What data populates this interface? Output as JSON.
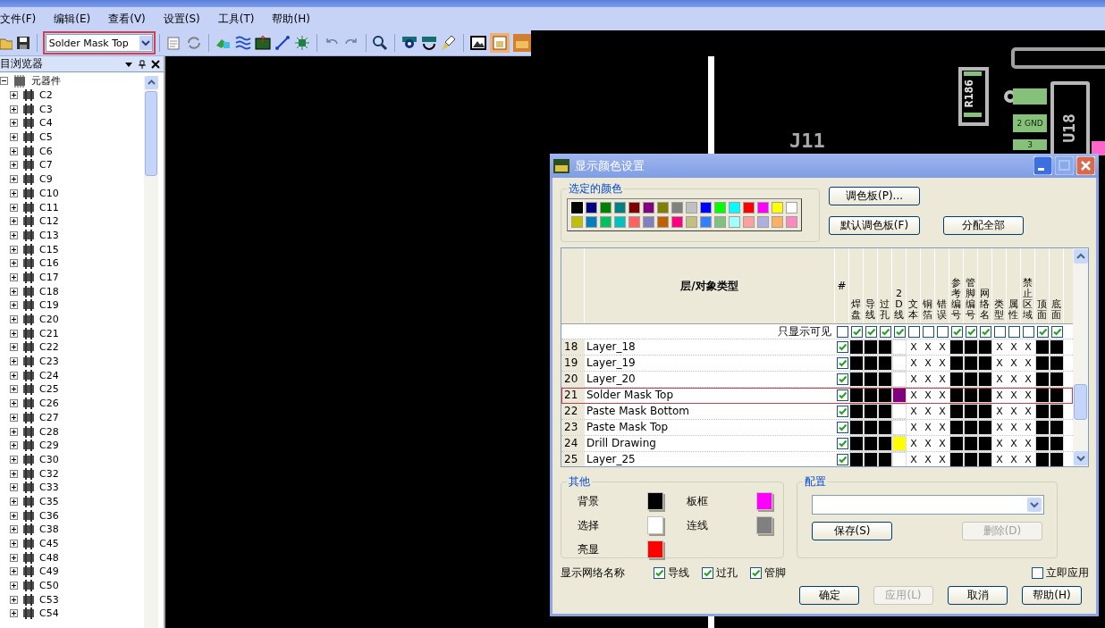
{
  "menu": [
    "文件(F)",
    "编辑(E)",
    "查看(V)",
    "设置(S)",
    "工具(T)",
    "帮助(H)"
  ],
  "toolbar": {
    "layer_select": "Solder Mask Top"
  },
  "browser": {
    "title": "目浏览器",
    "tree": [
      {
        "label": "元器件",
        "expanded": true,
        "children": [
          {
            "label": "C2",
            "expanded": false
          },
          {
            "label": "C3",
            "expanded": false
          },
          {
            "label": "C4",
            "expanded": false
          },
          {
            "label": "C5",
            "expanded": false
          },
          {
            "label": "C6",
            "expanded": false
          },
          {
            "label": "C7",
            "expanded": false
          },
          {
            "label": "C9",
            "expanded": false
          },
          {
            "label": "C10",
            "expanded": false
          },
          {
            "label": "C11",
            "expanded": false
          },
          {
            "label": "C12",
            "expanded": false
          },
          {
            "label": "C13",
            "expanded": false
          },
          {
            "label": "C15",
            "expanded": false
          },
          {
            "label": "C16",
            "expanded": false
          },
          {
            "label": "C17",
            "expanded": false
          },
          {
            "label": "C18",
            "expanded": false
          },
          {
            "label": "C19",
            "expanded": false
          },
          {
            "label": "C20",
            "expanded": false
          },
          {
            "label": "C21",
            "expanded": false
          },
          {
            "label": "C22",
            "expanded": false
          },
          {
            "label": "C23",
            "expanded": false
          },
          {
            "label": "C24",
            "expanded": false
          },
          {
            "label": "C25",
            "expanded": false
          },
          {
            "label": "C26",
            "expanded": false
          },
          {
            "label": "C27",
            "expanded": false
          },
          {
            "label": "C28",
            "expanded": false
          },
          {
            "label": "C29",
            "expanded": false
          },
          {
            "label": "C30",
            "expanded": false
          },
          {
            "label": "C32",
            "expanded": false
          },
          {
            "label": "C33",
            "expanded": false
          },
          {
            "label": "C35",
            "expanded": false
          },
          {
            "label": "C36",
            "expanded": false
          },
          {
            "label": "C38",
            "expanded": false
          },
          {
            "label": "C45",
            "expanded": false
          },
          {
            "label": "C48",
            "expanded": false
          },
          {
            "label": "C49",
            "expanded": false
          },
          {
            "label": "C50",
            "expanded": false
          },
          {
            "label": "C53",
            "expanded": false
          },
          {
            "label": "C54",
            "expanded": false
          }
        ]
      }
    ]
  },
  "pcb": {
    "ref_labels": [
      "J11",
      "R186",
      "U18"
    ],
    "pad_labels": [
      "2 GND",
      "3"
    ]
  },
  "dialog": {
    "title": "显示颜色设置",
    "selected_colors": {
      "title": "选定的颜色",
      "swatches": [
        {
          "color": "#000000",
          "selected": true
        },
        {
          "color": "#000080",
          "selected": false
        },
        {
          "color": "#008000",
          "selected": false
        },
        {
          "color": "#008080",
          "selected": false
        },
        {
          "color": "#800000",
          "selected": false
        },
        {
          "color": "#800080",
          "selected": false
        },
        {
          "color": "#808000",
          "selected": false
        },
        {
          "color": "#808080",
          "selected": false
        },
        {
          "color": "#c0c0c0",
          "selected": false
        },
        {
          "color": "#0000ff",
          "selected": false
        },
        {
          "color": "#00ff00",
          "selected": false
        },
        {
          "color": "#00ffff",
          "selected": false
        },
        {
          "color": "#ff0000",
          "selected": false
        },
        {
          "color": "#ff00ff",
          "selected": false
        },
        {
          "color": "#ffff00",
          "selected": false
        },
        {
          "color": "#ffffff",
          "selected": false
        },
        {
          "color": "#c0c000",
          "selected": false
        },
        {
          "color": "#0080c0",
          "selected": false
        },
        {
          "color": "#00c060",
          "selected": false
        },
        {
          "color": "#00c0c0",
          "selected": false
        },
        {
          "color": "#ff6060",
          "selected": false
        },
        {
          "color": "#8080c0",
          "selected": false
        },
        {
          "color": "#c06000",
          "selected": false
        },
        {
          "color": "#ff0080",
          "selected": false
        },
        {
          "color": "#c0c080",
          "selected": false
        },
        {
          "color": "#3080ff",
          "selected": false
        },
        {
          "color": "#80c080",
          "selected": false
        },
        {
          "color": "#a0ffff",
          "selected": false
        },
        {
          "color": "#ffa0a0",
          "selected": false
        },
        {
          "color": "#b0b0e0",
          "selected": false
        },
        {
          "color": "#ffb060",
          "selected": false
        },
        {
          "color": "#ff88c0",
          "selected": false
        }
      ]
    },
    "palette_buttons": [
      "调色板(P)...",
      "默认调色板(F)",
      "分配全部"
    ],
    "table": {
      "header_name": "层/对象类型",
      "header_hash": "#",
      "columns": [
        "焊盘",
        "导线",
        "过孔",
        "2D线",
        "文本",
        "铜箔",
        "错误",
        "参考编号",
        "管脚编号",
        "网络名",
        "类型",
        "属性",
        "禁止区域",
        "顶面",
        "底面"
      ],
      "visible_only": {
        "label": "只显示可见",
        "hash_checked": false,
        "checks": [
          true,
          true,
          true,
          true,
          false,
          false,
          false,
          true,
          true,
          true,
          false,
          false,
          false,
          true,
          true
        ]
      },
      "rows": [
        {
          "num": "18",
          "name": "Layer_18",
          "checked": true,
          "selected": false,
          "cells": [
            {
              "kind": "color",
              "color": "#000000"
            },
            {
              "kind": "color",
              "color": "#000000"
            },
            {
              "kind": "color",
              "color": "#000000"
            },
            {
              "kind": "color",
              "color": "#ffffff"
            },
            {
              "kind": "na",
              "text": "X"
            },
            {
              "kind": "na",
              "text": "X"
            },
            {
              "kind": "na",
              "text": "X"
            },
            {
              "kind": "color",
              "color": "#000000"
            },
            {
              "kind": "color",
              "color": "#000000"
            },
            {
              "kind": "color",
              "color": "#000000"
            },
            {
              "kind": "na",
              "text": "X"
            },
            {
              "kind": "na",
              "text": "X"
            },
            {
              "kind": "na",
              "text": "X"
            },
            {
              "kind": "color",
              "color": "#000000"
            },
            {
              "kind": "color",
              "color": "#000000"
            }
          ]
        },
        {
          "num": "19",
          "name": "Layer_19",
          "checked": true,
          "selected": false,
          "cells": [
            {
              "kind": "color",
              "color": "#000000"
            },
            {
              "kind": "color",
              "color": "#000000"
            },
            {
              "kind": "color",
              "color": "#000000"
            },
            {
              "kind": "color",
              "color": "#ffffff"
            },
            {
              "kind": "na",
              "text": "X"
            },
            {
              "kind": "na",
              "text": "X"
            },
            {
              "kind": "na",
              "text": "X"
            },
            {
              "kind": "color",
              "color": "#000000"
            },
            {
              "kind": "color",
              "color": "#000000"
            },
            {
              "kind": "color",
              "color": "#000000"
            },
            {
              "kind": "na",
              "text": "X"
            },
            {
              "kind": "na",
              "text": "X"
            },
            {
              "kind": "na",
              "text": "X"
            },
            {
              "kind": "color",
              "color": "#000000"
            },
            {
              "kind": "color",
              "color": "#000000"
            }
          ]
        },
        {
          "num": "20",
          "name": "Layer_20",
          "checked": true,
          "selected": false,
          "cells": [
            {
              "kind": "color",
              "color": "#000000"
            },
            {
              "kind": "color",
              "color": "#000000"
            },
            {
              "kind": "color",
              "color": "#000000"
            },
            {
              "kind": "color",
              "color": "#ffffff"
            },
            {
              "kind": "na",
              "text": "X"
            },
            {
              "kind": "na",
              "text": "X"
            },
            {
              "kind": "na",
              "text": "X"
            },
            {
              "kind": "color",
              "color": "#000000"
            },
            {
              "kind": "color",
              "color": "#000000"
            },
            {
              "kind": "color",
              "color": "#000000"
            },
            {
              "kind": "na",
              "text": "X"
            },
            {
              "kind": "na",
              "text": "X"
            },
            {
              "kind": "na",
              "text": "X"
            },
            {
              "kind": "color",
              "color": "#000000"
            },
            {
              "kind": "color",
              "color": "#000000"
            }
          ]
        },
        {
          "num": "21",
          "name": "Solder Mask Top",
          "checked": true,
          "selected": true,
          "cells": [
            {
              "kind": "color",
              "color": "#000000"
            },
            {
              "kind": "color",
              "color": "#000000"
            },
            {
              "kind": "color",
              "color": "#000000"
            },
            {
              "kind": "color",
              "color": "#800080"
            },
            {
              "kind": "na",
              "text": "X"
            },
            {
              "kind": "na",
              "text": "X"
            },
            {
              "kind": "na",
              "text": "X"
            },
            {
              "kind": "color",
              "color": "#000000"
            },
            {
              "kind": "color",
              "color": "#000000"
            },
            {
              "kind": "color",
              "color": "#000000"
            },
            {
              "kind": "na",
              "text": "X"
            },
            {
              "kind": "na",
              "text": "X"
            },
            {
              "kind": "na",
              "text": "X"
            },
            {
              "kind": "color",
              "color": "#000000"
            },
            {
              "kind": "color",
              "color": "#000000"
            }
          ]
        },
        {
          "num": "22",
          "name": "Paste Mask Bottom",
          "checked": true,
          "selected": false,
          "cells": [
            {
              "kind": "color",
              "color": "#000000"
            },
            {
              "kind": "color",
              "color": "#000000"
            },
            {
              "kind": "color",
              "color": "#000000"
            },
            {
              "kind": "color",
              "color": "#ffffff"
            },
            {
              "kind": "na",
              "text": "X"
            },
            {
              "kind": "na",
              "text": "X"
            },
            {
              "kind": "na",
              "text": "X"
            },
            {
              "kind": "color",
              "color": "#000000"
            },
            {
              "kind": "color",
              "color": "#000000"
            },
            {
              "kind": "color",
              "color": "#000000"
            },
            {
              "kind": "na",
              "text": "X"
            },
            {
              "kind": "na",
              "text": "X"
            },
            {
              "kind": "na",
              "text": "X"
            },
            {
              "kind": "color",
              "color": "#000000"
            },
            {
              "kind": "color",
              "color": "#000000"
            }
          ]
        },
        {
          "num": "23",
          "name": "Paste Mask Top",
          "checked": true,
          "selected": false,
          "cells": [
            {
              "kind": "color",
              "color": "#000000"
            },
            {
              "kind": "color",
              "color": "#000000"
            },
            {
              "kind": "color",
              "color": "#000000"
            },
            {
              "kind": "color",
              "color": "#ffffff"
            },
            {
              "kind": "na",
              "text": "X"
            },
            {
              "kind": "na",
              "text": "X"
            },
            {
              "kind": "na",
              "text": "X"
            },
            {
              "kind": "color",
              "color": "#000000"
            },
            {
              "kind": "color",
              "color": "#000000"
            },
            {
              "kind": "color",
              "color": "#000000"
            },
            {
              "kind": "na",
              "text": "X"
            },
            {
              "kind": "na",
              "text": "X"
            },
            {
              "kind": "na",
              "text": "X"
            },
            {
              "kind": "color",
              "color": "#000000"
            },
            {
              "kind": "color",
              "color": "#000000"
            }
          ]
        },
        {
          "num": "24",
          "name": "Drill Drawing",
          "checked": true,
          "selected": false,
          "cells": [
            {
              "kind": "color",
              "color": "#000000"
            },
            {
              "kind": "color",
              "color": "#000000"
            },
            {
              "kind": "color",
              "color": "#000000"
            },
            {
              "kind": "color",
              "color": "#ffff00"
            },
            {
              "kind": "na",
              "text": "X"
            },
            {
              "kind": "na",
              "text": "X"
            },
            {
              "kind": "na",
              "text": "X"
            },
            {
              "kind": "color",
              "color": "#000000"
            },
            {
              "kind": "color",
              "color": "#000000"
            },
            {
              "kind": "color",
              "color": "#000000"
            },
            {
              "kind": "na",
              "text": "X"
            },
            {
              "kind": "na",
              "text": "X"
            },
            {
              "kind": "na",
              "text": "X"
            },
            {
              "kind": "color",
              "color": "#000000"
            },
            {
              "kind": "color",
              "color": "#000000"
            }
          ]
        },
        {
          "num": "25",
          "name": "Layer_25",
          "checked": true,
          "selected": false,
          "cells": [
            {
              "kind": "color",
              "color": "#000000"
            },
            {
              "kind": "color",
              "color": "#000000"
            },
            {
              "kind": "color",
              "color": "#000000"
            },
            {
              "kind": "color",
              "color": "#ffffff"
            },
            {
              "kind": "na",
              "text": "X"
            },
            {
              "kind": "na",
              "text": "X"
            },
            {
              "kind": "na",
              "text": "X"
            },
            {
              "kind": "color",
              "color": "#000000"
            },
            {
              "kind": "color",
              "color": "#000000"
            },
            {
              "kind": "color",
              "color": "#000000"
            },
            {
              "kind": "na",
              "text": "X"
            },
            {
              "kind": "na",
              "text": "X"
            },
            {
              "kind": "na",
              "text": "X"
            },
            {
              "kind": "color",
              "color": "#000000"
            },
            {
              "kind": "color",
              "color": "#000000"
            }
          ]
        }
      ]
    },
    "other": {
      "title": "其他",
      "items": [
        {
          "label": "背景",
          "color": "#000000"
        },
        {
          "label": "板框",
          "color": "#ff00ff"
        },
        {
          "label": "选择",
          "color": "#ffffff"
        },
        {
          "label": "连线",
          "color": "#808080"
        },
        {
          "label": "亮显",
          "color": "#ff0000"
        }
      ]
    },
    "config": {
      "title": "配置",
      "buttons": [
        {
          "label": "保存(S)",
          "disabled": false
        },
        {
          "label": "删除(D)",
          "disabled": true
        }
      ]
    },
    "net_names": {
      "label": "显示网络名称",
      "options": [
        {
          "label": "导线",
          "checked": true
        },
        {
          "label": "过孔",
          "checked": true
        },
        {
          "label": "管脚",
          "checked": true
        }
      ]
    },
    "apply_now": {
      "label": "立即应用",
      "checked": false
    },
    "footer_buttons": [
      {
        "label": "确定",
        "disabled": false
      },
      {
        "label": "应用(L)",
        "disabled": true
      },
      {
        "label": "取消",
        "disabled": false
      },
      {
        "label": "帮助(H)",
        "disabled": false
      }
    ]
  }
}
